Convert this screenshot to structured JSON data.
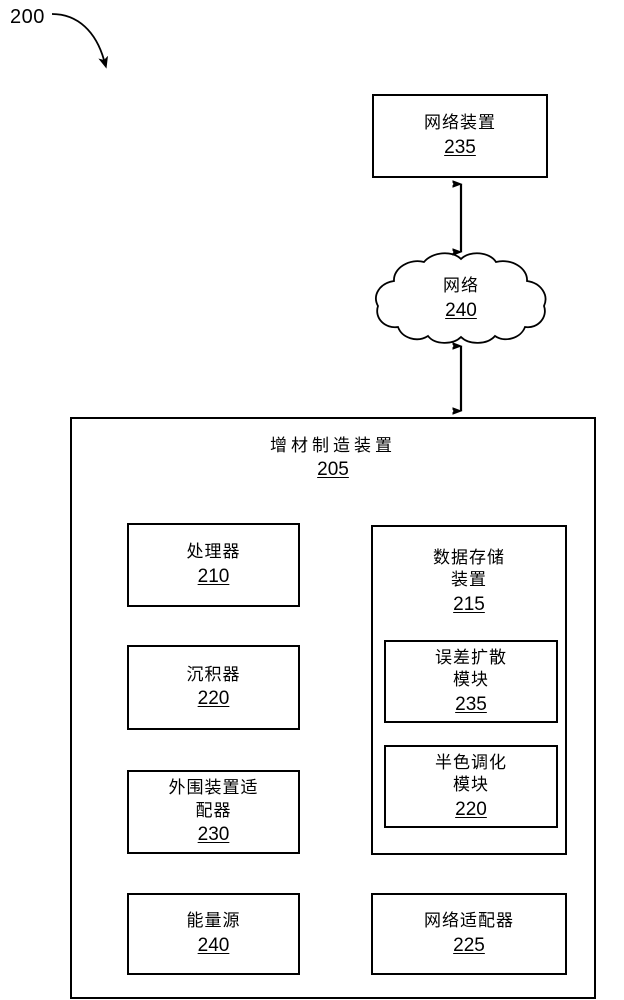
{
  "figure": {
    "label": "200",
    "pointer_icon": "curved-arrow-icon"
  },
  "nodes": {
    "network_device": {
      "title": "网络装置",
      "ref": "235"
    },
    "network_cloud": {
      "title": "网络",
      "ref": "240",
      "icon": "cloud-shape-icon"
    },
    "additive_manufacturing_device": {
      "title": "增材制造装置",
      "ref": "205"
    },
    "processor": {
      "title": "处理器",
      "ref": "210"
    },
    "depositor": {
      "title": "沉积器",
      "ref": "220"
    },
    "peripheral_device_adapter": {
      "title": "外围装置适\n配器",
      "ref": "230"
    },
    "energy_source": {
      "title": "能量源",
      "ref": "240"
    },
    "data_storage_device": {
      "title": "数据存储\n装置",
      "ref": "215"
    },
    "error_diffusion_module": {
      "title": "误差扩散\n模块",
      "ref": "235"
    },
    "halftoning_module": {
      "title": "半色调化\n模块",
      "ref": "220"
    },
    "network_adapter": {
      "title": "网络适配器",
      "ref": "225"
    }
  },
  "connectors": [
    {
      "name": "network-device-to-cloud",
      "icon": "double-headed-arrow-icon",
      "from": "network_device",
      "to": "network_cloud"
    },
    {
      "name": "cloud-to-device",
      "icon": "double-headed-arrow-icon",
      "from": "network_cloud",
      "to": "additive_manufacturing_device"
    }
  ],
  "style": {
    "line_color": "#000000",
    "background": "#ffffff"
  }
}
